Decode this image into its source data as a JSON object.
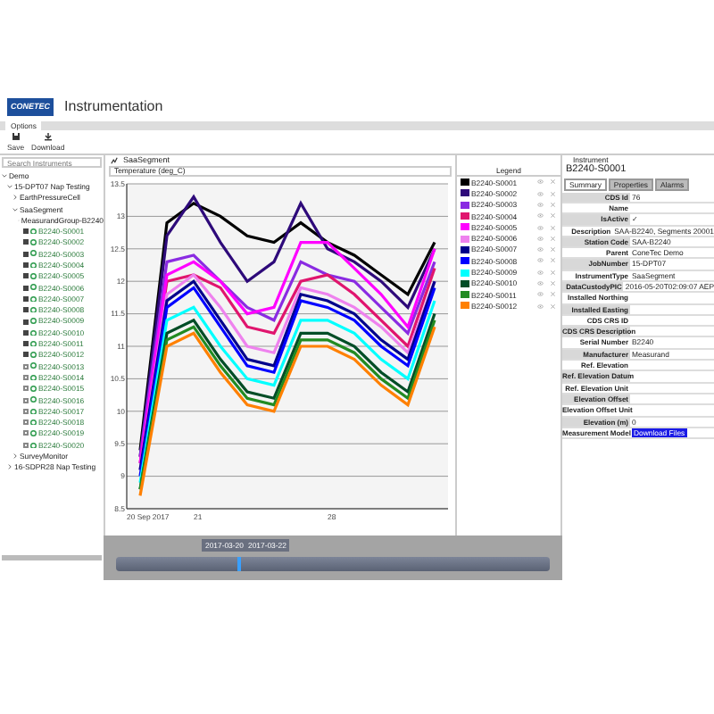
{
  "app": {
    "logo": "CONETEC",
    "title": "Instrumentation"
  },
  "ribbon_tabs": [
    {
      "label": "Options",
      "selected": true
    }
  ],
  "toolbar": [
    {
      "label": "Save"
    },
    {
      "label": "Download"
    }
  ],
  "tree": {
    "search": {
      "placeholder": "Search Instruments"
    },
    "items": [
      {
        "label": "Demo",
        "expanded": true,
        "children": [
          {
            "label": "15-DPT07 Nap Testing",
            "expanded": true,
            "children": [
              {
                "label": "EarthPressureCell",
                "expanded": false
              },
              {
                "label": "SaaSegment",
                "expanded": true,
                "children": [
                  {
                    "label": "MeasurandGroup-B2240",
                    "expanded": true,
                    "children": [
                      {
                        "label": "B2240-S0001",
                        "checked": true
                      },
                      {
                        "label": "B2240-S0002",
                        "checked": true
                      },
                      {
                        "label": "B2240-S0003",
                        "checked": true
                      },
                      {
                        "label": "B2240-S0004",
                        "checked": true
                      },
                      {
                        "label": "B2240-S0005",
                        "checked": true
                      },
                      {
                        "label": "B2240-S0006",
                        "checked": true
                      },
                      {
                        "label": "B2240-S0007",
                        "checked": true
                      },
                      {
                        "label": "B2240-S0008",
                        "checked": true
                      },
                      {
                        "label": "B2240-S0009",
                        "checked": true
                      },
                      {
                        "label": "B2240-S0010",
                        "checked": true
                      },
                      {
                        "label": "B2240-S0011",
                        "checked": true
                      },
                      {
                        "label": "B2240-S0012",
                        "checked": true
                      },
                      {
                        "label": "B2240-S0013",
                        "checked": false
                      },
                      {
                        "label": "B2240-S0014",
                        "checked": false
                      },
                      {
                        "label": "B2240-S0015",
                        "checked": false
                      },
                      {
                        "label": "B2240-S0016",
                        "checked": false
                      },
                      {
                        "label": "B2240-S0017",
                        "checked": false
                      },
                      {
                        "label": "B2240-S0018",
                        "checked": false
                      },
                      {
                        "label": "B2240-S0019",
                        "checked": false
                      },
                      {
                        "label": "B2240-S0020",
                        "checked": false
                      }
                    ]
                  }
                ]
              },
              {
                "label": "SurveyMonitor",
                "expanded": false
              }
            ]
          },
          {
            "label": "16-SDPR28 Nap Testing",
            "expanded": false
          }
        ]
      }
    ]
  },
  "chart_panel": {
    "title": "SaaSegment",
    "axis_title": "Temperature (deg_C)",
    "chart_data": {
      "type": "line",
      "categories": [
        "20 Sep 2017",
        null,
        "21",
        null,
        null,
        null,
        null,
        "28",
        null,
        null,
        null,
        null
      ],
      "ylim": [
        8.5,
        13.5
      ],
      "grid": true,
      "yticks": [
        8.5,
        9,
        9.5,
        10,
        10.5,
        11,
        11.5,
        12,
        12.5,
        13,
        13.5
      ],
      "series": [
        {
          "name": "B2240-S0001",
          "color": "#000000",
          "values": [
            9.4,
            12.9,
            13.2,
            13.0,
            12.7,
            12.6,
            12.9,
            12.6,
            12.4,
            12.1,
            11.8,
            12.6
          ]
        },
        {
          "name": "B2240-S0002",
          "color": "#2e0a7a",
          "values": [
            9.3,
            12.7,
            13.3,
            12.6,
            12.0,
            12.3,
            13.2,
            12.5,
            12.3,
            12.0,
            11.6,
            12.5
          ]
        },
        {
          "name": "B2240-S0003",
          "color": "#8a2be2",
          "values": [
            9.3,
            12.3,
            12.4,
            12.0,
            11.6,
            11.4,
            12.3,
            12.1,
            12.0,
            11.6,
            11.2,
            12.3
          ]
        },
        {
          "name": "B2240-S0004",
          "color": "#e0156e",
          "values": [
            9.2,
            12.0,
            12.1,
            11.9,
            11.3,
            11.2,
            12.0,
            12.1,
            11.8,
            11.4,
            11.0,
            12.2
          ]
        },
        {
          "name": "B2240-S0005",
          "color": "#ff00ff",
          "values": [
            9.2,
            12.1,
            12.3,
            12.0,
            11.5,
            11.6,
            12.6,
            12.6,
            12.2,
            11.8,
            11.3,
            12.5
          ]
        },
        {
          "name": "B2240-S0006",
          "color": "#ee82ee",
          "values": [
            9.1,
            11.8,
            12.1,
            11.6,
            11.0,
            10.9,
            11.9,
            11.8,
            11.6,
            11.3,
            10.9,
            12.0
          ]
        },
        {
          "name": "B2240-S0007",
          "color": "#00008b",
          "values": [
            9.1,
            11.7,
            12.0,
            11.4,
            10.8,
            10.7,
            11.8,
            11.7,
            11.5,
            11.1,
            10.8,
            12.0
          ]
        },
        {
          "name": "B2240-S0008",
          "color": "#0000ff",
          "values": [
            9.0,
            11.6,
            11.9,
            11.3,
            10.7,
            10.6,
            11.7,
            11.6,
            11.4,
            11.0,
            10.7,
            11.9
          ]
        },
        {
          "name": "B2240-S0009",
          "color": "#00ffff",
          "values": [
            8.9,
            11.4,
            11.6,
            11.0,
            10.5,
            10.4,
            11.4,
            11.4,
            11.2,
            10.8,
            10.5,
            11.7
          ]
        },
        {
          "name": "B2240-S0010",
          "color": "#004d26",
          "values": [
            8.8,
            11.2,
            11.4,
            10.8,
            10.3,
            10.2,
            11.2,
            11.2,
            11.0,
            10.6,
            10.3,
            11.5
          ]
        },
        {
          "name": "B2240-S0011",
          "color": "#228b22",
          "values": [
            8.8,
            11.1,
            11.3,
            10.7,
            10.2,
            10.1,
            11.1,
            11.1,
            10.9,
            10.5,
            10.2,
            11.4
          ]
        },
        {
          "name": "B2240-S0012",
          "color": "#ff8000",
          "values": [
            8.7,
            11.0,
            11.2,
            10.6,
            10.1,
            10.0,
            11.0,
            11.0,
            10.8,
            10.4,
            10.1,
            11.3
          ]
        }
      ]
    }
  },
  "legend": {
    "title": "Legend"
  },
  "instrument": {
    "heading": "Instrument",
    "name": "B2240-S0001",
    "tabs": [
      {
        "label": "Summary",
        "selected": true
      },
      {
        "label": "Properties",
        "selected": false
      },
      {
        "label": "Alarms",
        "selected": false
      }
    ],
    "properties": [
      {
        "label": "CDS Id",
        "value": "76"
      },
      {
        "label": "Name"
      },
      {
        "label": "IsActive",
        "value": "✓"
      },
      {
        "label": "Description",
        "value": "SAA-B2240, Segments 20001"
      },
      {
        "label": "Station Code",
        "value": "SAA-B2240"
      },
      {
        "label": "Parent",
        "value": "ConeTec Demo"
      },
      {
        "label": "JobNumber",
        "value": "15-DPT07"
      },
      {
        "label": "InstrumentType",
        "value": "SaaSegment"
      },
      {
        "label": "DataCustodyPIC",
        "value": "2016-05-20T02:09:07 AEP"
      },
      {
        "label": "Installed Northing"
      },
      {
        "label": "Installed Easting"
      },
      {
        "label": "CDS CRS ID"
      },
      {
        "label": "CDS CRS Description"
      },
      {
        "label": "Serial Number",
        "value": "B2240"
      },
      {
        "label": "Manufacturer",
        "value": "Measurand"
      },
      {
        "label": "Ref. Elevation"
      },
      {
        "label": "Ref. Elevation Datum"
      },
      {
        "label": "Ref. Elevation Unit"
      },
      {
        "label": "Elevation Offset"
      },
      {
        "label": "Elevation Offset Unit"
      },
      {
        "label": "Elevation (m)",
        "value": "0"
      },
      {
        "label": "Measurement Model",
        "value": "Download Files",
        "kind": "link"
      }
    ]
  },
  "timeline": {
    "start_label": "2017-03-20",
    "end_label": "2017-03-22",
    "level": 0.28
  }
}
